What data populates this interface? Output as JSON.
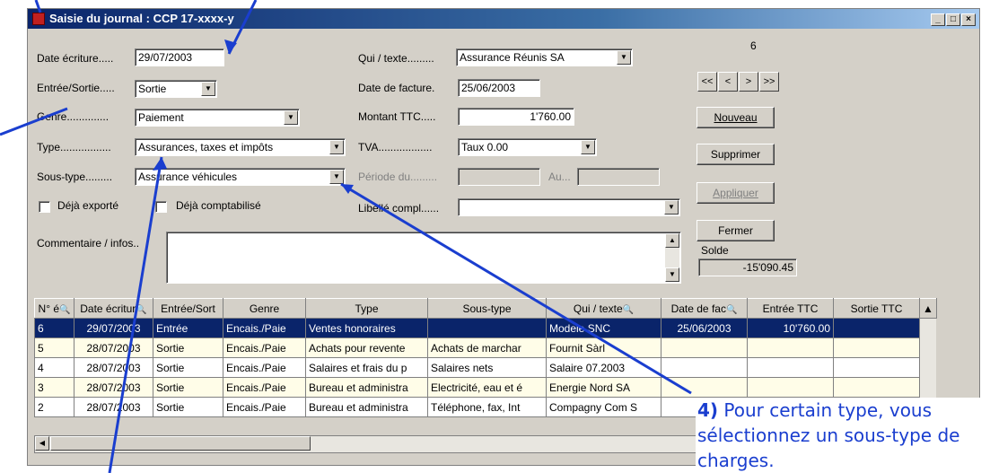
{
  "window": {
    "title": "Saisie du journal : CCP 17-xxxx-y",
    "min_glyph": "_",
    "max_glyph": "□",
    "close_glyph": "×"
  },
  "form": {
    "date_ecriture": {
      "label": "Date écriture.....",
      "value": "29/07/2003"
    },
    "entree_sortie": {
      "label": "Entrée/Sortie.....",
      "value": "Sortie"
    },
    "genre": {
      "label": "Genre..............",
      "value": "Paiement"
    },
    "type": {
      "label": "Type.................",
      "value": "Assurances, taxes et impôts"
    },
    "sous_type": {
      "label": "Sous-type.........",
      "value": "Assurance véhicules"
    },
    "deja_exporte": {
      "label": "Déjà exporté",
      "checked": false
    },
    "deja_comptabilise": {
      "label": "Déjà comptabilisé",
      "checked": false
    },
    "commentaire": {
      "label": "Commentaire / infos..",
      "value": ""
    },
    "qui_texte": {
      "label": "Qui / texte.........",
      "value": "Assurance Réunis SA"
    },
    "date_facture": {
      "label": "Date de facture.",
      "value": "25/06/2003"
    },
    "montant_ttc": {
      "label": "Montant TTC.....",
      "value": "1'760.00"
    },
    "tva": {
      "label": "TVA..................",
      "value": "Taux 0.00"
    },
    "periode_du": {
      "label": "Période du.........",
      "value": ""
    },
    "au": {
      "label": "Au...",
      "value": ""
    },
    "libelle_compl": {
      "label": "Libellé compl......",
      "value": ""
    }
  },
  "record_counter": "6",
  "nav": {
    "first": "<<",
    "prev": "<",
    "next": ">",
    "last": ">>"
  },
  "buttons": {
    "nouveau": "Nouveau",
    "supprimer": "Supprimer",
    "appliquer": "Appliquer",
    "fermer": "Fermer"
  },
  "solde": {
    "label": "Solde",
    "value": "-15'090.45"
  },
  "table": {
    "columns": [
      "N° é",
      "Date écritur",
      "Entrée/Sort",
      "Genre",
      "Type",
      "Sous-type",
      "Qui / texte",
      "Date de fac",
      "Entrée TTC",
      "Sortie TTC"
    ],
    "rows": [
      [
        "6",
        "29/07/2003",
        "Entrée",
        "Encais./Paie",
        "Ventes honoraires",
        "",
        "Modele SNC",
        "25/06/2003",
        "10'760.00",
        ""
      ],
      [
        "5",
        "28/07/2003",
        "Sortie",
        "Encais./Paie",
        "Achats pour revente",
        "Achats de marchar",
        "Fournit Sàrl",
        "",
        "",
        ""
      ],
      [
        "4",
        "28/07/2003",
        "Sortie",
        "Encais./Paie",
        "Salaires et frais du p",
        "Salaires nets",
        "Salaire 07.2003",
        "",
        "",
        ""
      ],
      [
        "3",
        "28/07/2003",
        "Sortie",
        "Encais./Paie",
        "Bureau et administra",
        "Electricité, eau et é",
        "Energie Nord SA",
        "",
        "",
        ""
      ],
      [
        "2",
        "28/07/2003",
        "Sortie",
        "Encais./Paie",
        "Bureau et administra",
        "Téléphone, fax, Int",
        "Compagny Com S",
        "",
        "",
        ""
      ]
    ]
  },
  "annotation": {
    "number": "4)",
    "text": " Pour certain type, vous sélectionnez un sous-type de charges."
  },
  "colors": {
    "annotation": "#1a3ecf",
    "selection": "#0a246a",
    "alt_row": "#fffde8"
  }
}
